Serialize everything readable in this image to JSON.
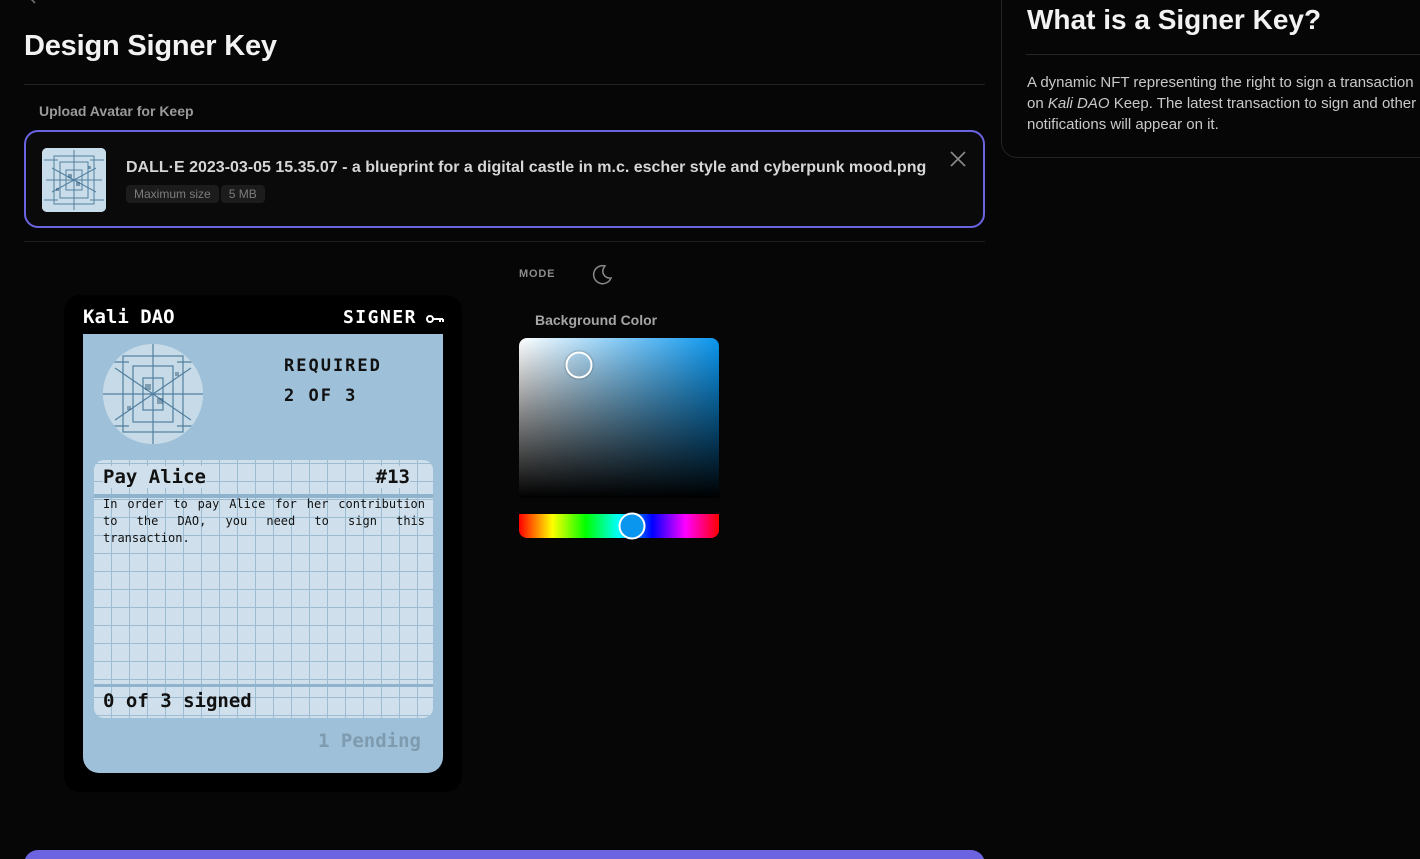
{
  "header": {
    "title": "Design Signer Key"
  },
  "upload": {
    "label": "Upload Avatar for Keep",
    "file_name": "DALL·E 2023-03-05 15.35.07 - a blueprint for a digital castle in m.c. escher style and cyberpunk mood.png",
    "max_size_label": "Maximum size",
    "max_size_value": "5 MB"
  },
  "mode": {
    "label": "MODE",
    "icon": "moon-icon"
  },
  "card": {
    "org_name": "Kali DAO",
    "badge": "SIGNER",
    "badge_icon": "key-icon",
    "required_label": "REQUIRED",
    "required_value": "2 OF 3",
    "transaction": {
      "title": "Pay Alice",
      "number": "#13",
      "description": "In order to pay Alice for her contribution to the DAO, you need to sign this transaction.",
      "signed_status": "0 of 3 signed"
    },
    "pending": "1 Pending",
    "background_color": "#9ec0d8"
  },
  "color_picker": {
    "label": "Background Color",
    "hue_color": "#0a96ee"
  },
  "info": {
    "title": "What is a Signer Key?",
    "text_before": "A dynamic NFT representing the right to sign a transaction on ",
    "text_emphasis": "Kali DAO",
    "text_after": " Keep. The latest transaction to sign and other notifications will appear on it."
  },
  "colors": {
    "accent": "#6b63e0",
    "background": "#060606"
  }
}
